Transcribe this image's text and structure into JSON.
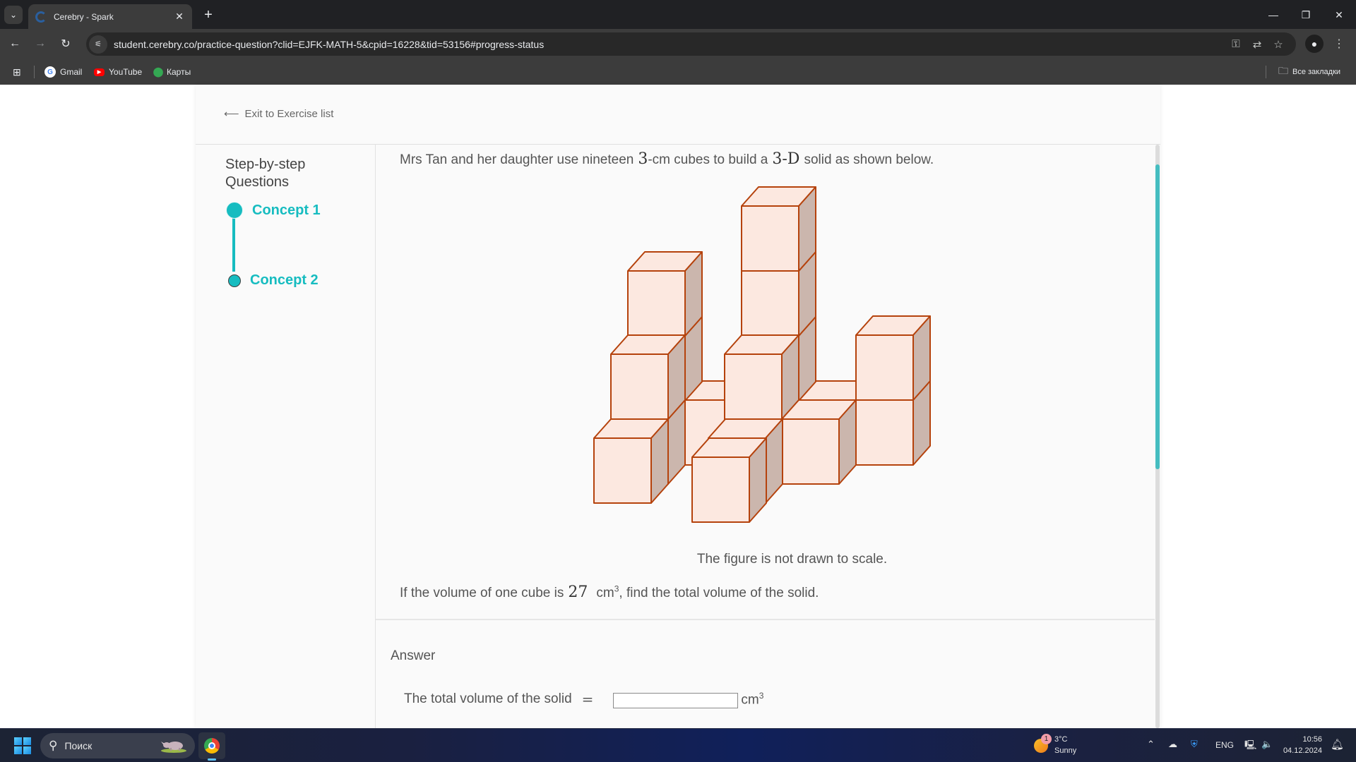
{
  "browser": {
    "tab_title": "Cerebry - Spark",
    "tab_close": "✕",
    "new_tab": "+",
    "url": "student.cerebry.co/practice-question?clid=EJFK-MATH-5&cpid=16228&tid=53156#progress-status",
    "bookmarks": [
      {
        "label": "Gmail",
        "icon": "google-icon"
      },
      {
        "label": "YouTube",
        "icon": "youtube-icon"
      },
      {
        "label": "Карты",
        "icon": "maps-icon"
      }
    ],
    "all_bookmarks": "Все закладки"
  },
  "page": {
    "exit_link": "Exit to Exercise list",
    "sidebar": {
      "title": "Step-by-step Questions",
      "steps": [
        {
          "label": "Concept 1",
          "state": "current"
        },
        {
          "label": "Concept 2",
          "state": "upcoming"
        }
      ]
    },
    "question": {
      "text_1": "Mrs Tan and her daughter use nineteen",
      "math_1": "3",
      "text_2": "-cm cubes to build a",
      "math_2": "3-D",
      "text_3": "solid as shown below.",
      "figure": {
        "description": "3-D solid built from 19 unit cubes",
        "cube_count": 19,
        "face_color": "#fce8e0",
        "side_color": "#cbb6ad",
        "edge_color": "#b5420c"
      },
      "caption": "The figure is not drawn to scale.",
      "prompt_1": "If the volume of one cube is",
      "prompt_math": "27",
      "prompt_unit": "cm",
      "prompt_exp": "3",
      "prompt_2": ", find the total volume of the solid."
    },
    "answer": {
      "heading": "Answer",
      "label": "The total volume of the solid",
      "equals": "=",
      "value": "",
      "unit": "cm",
      "unit_exp": "3"
    },
    "scroll": {
      "accent": "#45bdc0"
    }
  },
  "taskbar": {
    "search_placeholder": "Поиск",
    "weather_badge": "1",
    "weather_temp": "3°C",
    "weather_desc": "Sunny",
    "language": "ENG",
    "time": "10:56",
    "date": "04.12.2024"
  }
}
